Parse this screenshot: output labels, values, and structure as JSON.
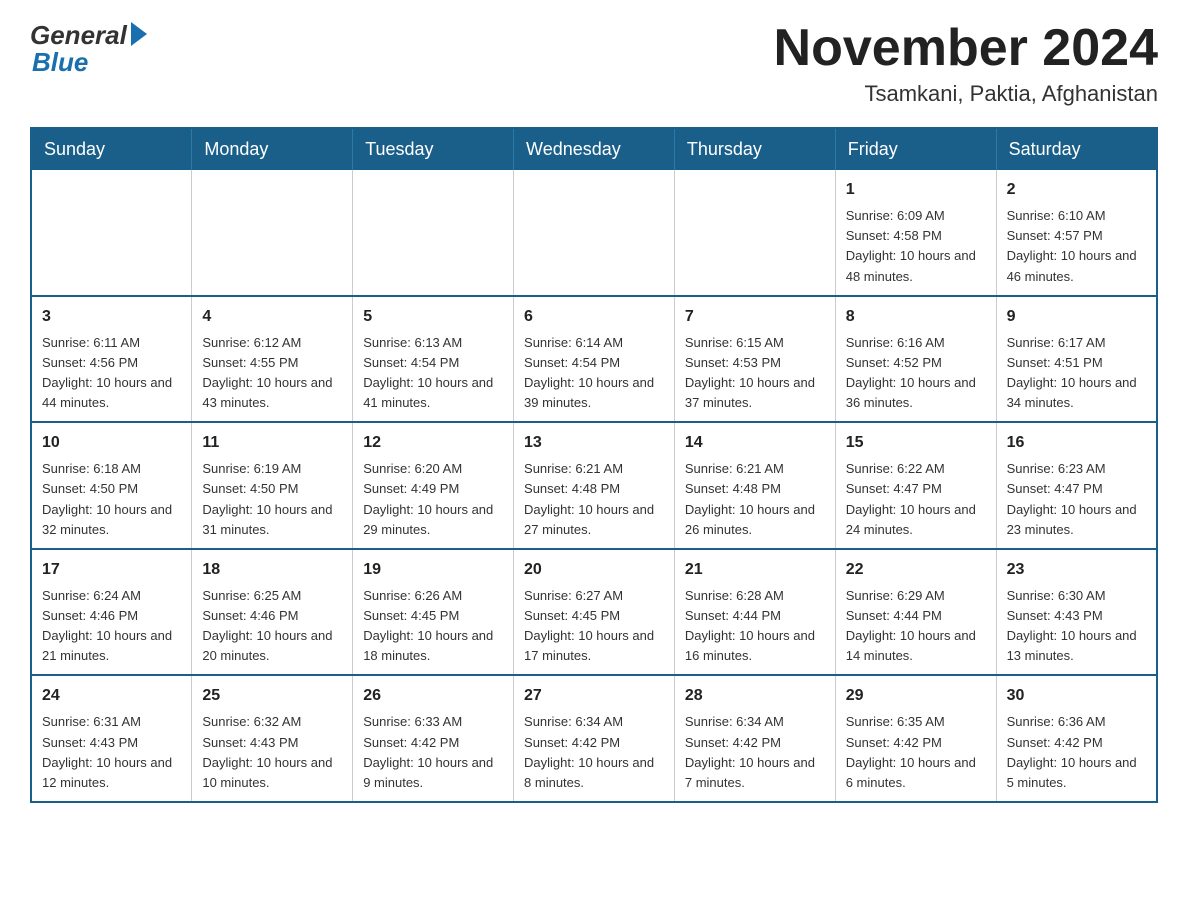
{
  "logo": {
    "general": "General",
    "blue": "Blue"
  },
  "header": {
    "month": "November 2024",
    "location": "Tsamkani, Paktia, Afghanistan"
  },
  "weekdays": [
    "Sunday",
    "Monday",
    "Tuesday",
    "Wednesday",
    "Thursday",
    "Friday",
    "Saturday"
  ],
  "weeks": [
    [
      {
        "day": "",
        "info": ""
      },
      {
        "day": "",
        "info": ""
      },
      {
        "day": "",
        "info": ""
      },
      {
        "day": "",
        "info": ""
      },
      {
        "day": "",
        "info": ""
      },
      {
        "day": "1",
        "info": "Sunrise: 6:09 AM\nSunset: 4:58 PM\nDaylight: 10 hours and 48 minutes."
      },
      {
        "day": "2",
        "info": "Sunrise: 6:10 AM\nSunset: 4:57 PM\nDaylight: 10 hours and 46 minutes."
      }
    ],
    [
      {
        "day": "3",
        "info": "Sunrise: 6:11 AM\nSunset: 4:56 PM\nDaylight: 10 hours and 44 minutes."
      },
      {
        "day": "4",
        "info": "Sunrise: 6:12 AM\nSunset: 4:55 PM\nDaylight: 10 hours and 43 minutes."
      },
      {
        "day": "5",
        "info": "Sunrise: 6:13 AM\nSunset: 4:54 PM\nDaylight: 10 hours and 41 minutes."
      },
      {
        "day": "6",
        "info": "Sunrise: 6:14 AM\nSunset: 4:54 PM\nDaylight: 10 hours and 39 minutes."
      },
      {
        "day": "7",
        "info": "Sunrise: 6:15 AM\nSunset: 4:53 PM\nDaylight: 10 hours and 37 minutes."
      },
      {
        "day": "8",
        "info": "Sunrise: 6:16 AM\nSunset: 4:52 PM\nDaylight: 10 hours and 36 minutes."
      },
      {
        "day": "9",
        "info": "Sunrise: 6:17 AM\nSunset: 4:51 PM\nDaylight: 10 hours and 34 minutes."
      }
    ],
    [
      {
        "day": "10",
        "info": "Sunrise: 6:18 AM\nSunset: 4:50 PM\nDaylight: 10 hours and 32 minutes."
      },
      {
        "day": "11",
        "info": "Sunrise: 6:19 AM\nSunset: 4:50 PM\nDaylight: 10 hours and 31 minutes."
      },
      {
        "day": "12",
        "info": "Sunrise: 6:20 AM\nSunset: 4:49 PM\nDaylight: 10 hours and 29 minutes."
      },
      {
        "day": "13",
        "info": "Sunrise: 6:21 AM\nSunset: 4:48 PM\nDaylight: 10 hours and 27 minutes."
      },
      {
        "day": "14",
        "info": "Sunrise: 6:21 AM\nSunset: 4:48 PM\nDaylight: 10 hours and 26 minutes."
      },
      {
        "day": "15",
        "info": "Sunrise: 6:22 AM\nSunset: 4:47 PM\nDaylight: 10 hours and 24 minutes."
      },
      {
        "day": "16",
        "info": "Sunrise: 6:23 AM\nSunset: 4:47 PM\nDaylight: 10 hours and 23 minutes."
      }
    ],
    [
      {
        "day": "17",
        "info": "Sunrise: 6:24 AM\nSunset: 4:46 PM\nDaylight: 10 hours and 21 minutes."
      },
      {
        "day": "18",
        "info": "Sunrise: 6:25 AM\nSunset: 4:46 PM\nDaylight: 10 hours and 20 minutes."
      },
      {
        "day": "19",
        "info": "Sunrise: 6:26 AM\nSunset: 4:45 PM\nDaylight: 10 hours and 18 minutes."
      },
      {
        "day": "20",
        "info": "Sunrise: 6:27 AM\nSunset: 4:45 PM\nDaylight: 10 hours and 17 minutes."
      },
      {
        "day": "21",
        "info": "Sunrise: 6:28 AM\nSunset: 4:44 PM\nDaylight: 10 hours and 16 minutes."
      },
      {
        "day": "22",
        "info": "Sunrise: 6:29 AM\nSunset: 4:44 PM\nDaylight: 10 hours and 14 minutes."
      },
      {
        "day": "23",
        "info": "Sunrise: 6:30 AM\nSunset: 4:43 PM\nDaylight: 10 hours and 13 minutes."
      }
    ],
    [
      {
        "day": "24",
        "info": "Sunrise: 6:31 AM\nSunset: 4:43 PM\nDaylight: 10 hours and 12 minutes."
      },
      {
        "day": "25",
        "info": "Sunrise: 6:32 AM\nSunset: 4:43 PM\nDaylight: 10 hours and 10 minutes."
      },
      {
        "day": "26",
        "info": "Sunrise: 6:33 AM\nSunset: 4:42 PM\nDaylight: 10 hours and 9 minutes."
      },
      {
        "day": "27",
        "info": "Sunrise: 6:34 AM\nSunset: 4:42 PM\nDaylight: 10 hours and 8 minutes."
      },
      {
        "day": "28",
        "info": "Sunrise: 6:34 AM\nSunset: 4:42 PM\nDaylight: 10 hours and 7 minutes."
      },
      {
        "day": "29",
        "info": "Sunrise: 6:35 AM\nSunset: 4:42 PM\nDaylight: 10 hours and 6 minutes."
      },
      {
        "day": "30",
        "info": "Sunrise: 6:36 AM\nSunset: 4:42 PM\nDaylight: 10 hours and 5 minutes."
      }
    ]
  ]
}
